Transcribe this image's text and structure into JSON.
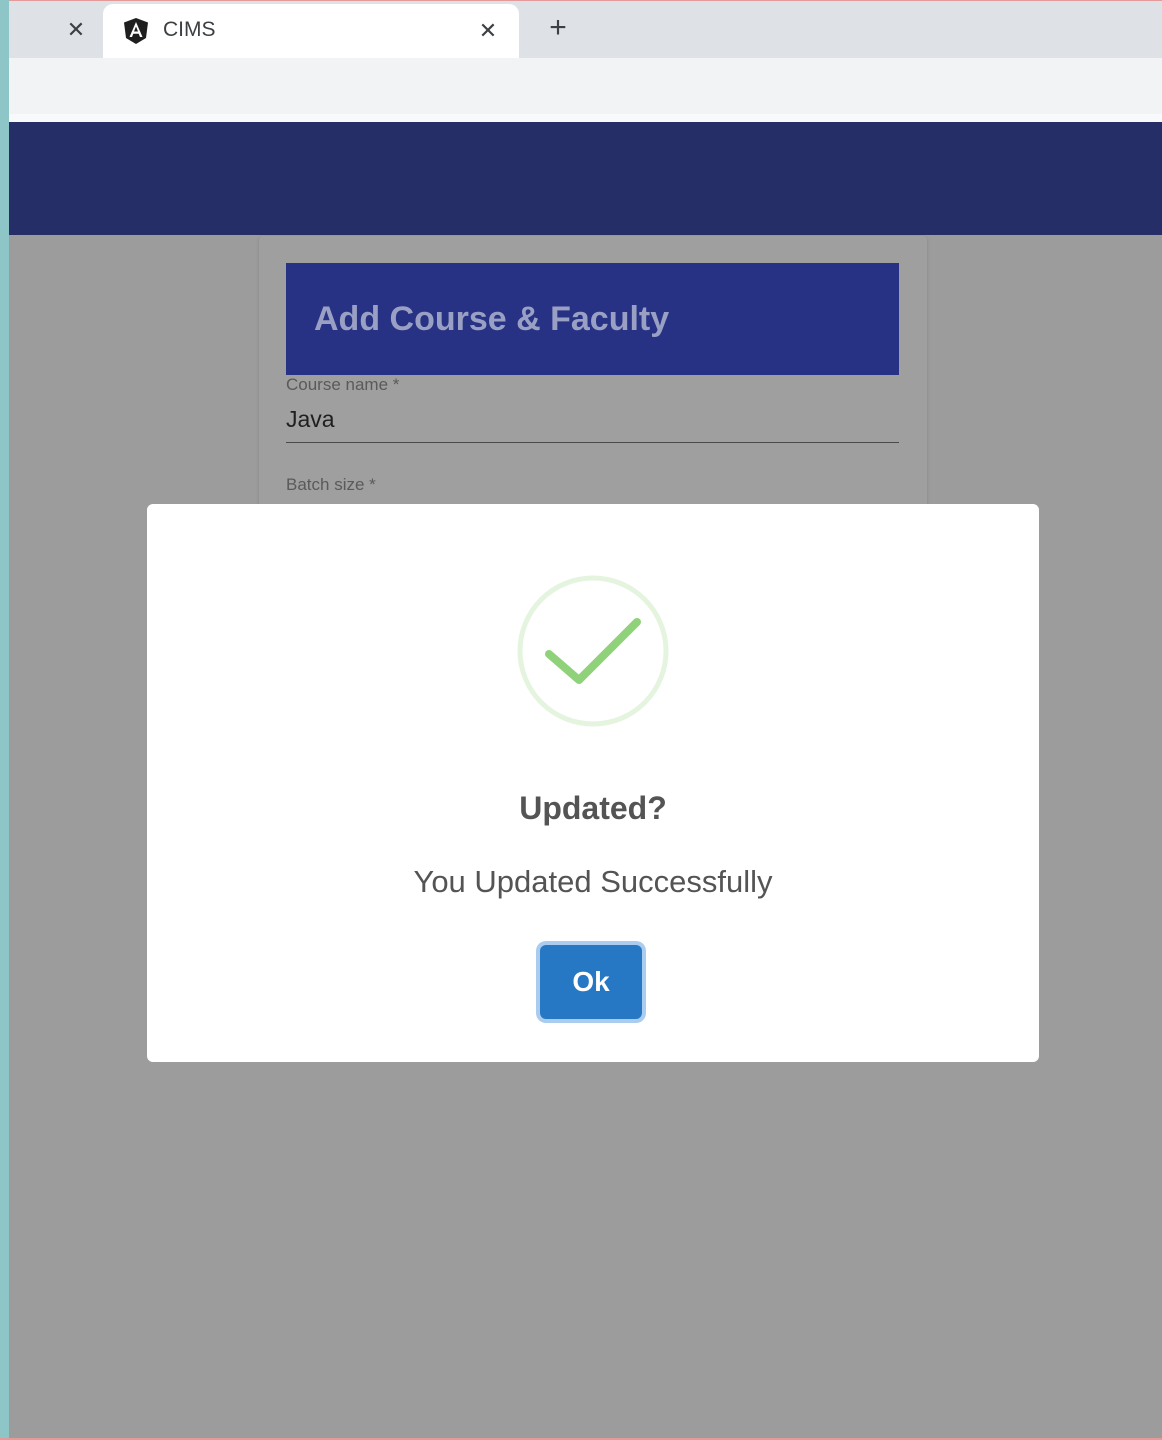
{
  "browser": {
    "tab_title": "CIMS",
    "close_glyph": "✕",
    "new_tab_glyph": "+",
    "favicon": "angular-icon"
  },
  "form": {
    "title": "Add Course & Faculty",
    "course_name_label": "Course name *",
    "course_name_value": "Java",
    "batch_size_label": "Batch size *"
  },
  "dialog": {
    "icon": "success-check-icon",
    "title": "Updated?",
    "message": "You Updated Successfully",
    "ok_label": "Ok"
  },
  "colors": {
    "header": "#262e68",
    "form_header": "#283284",
    "ok_button": "#2778c4",
    "success_green": "#8fd27a"
  }
}
